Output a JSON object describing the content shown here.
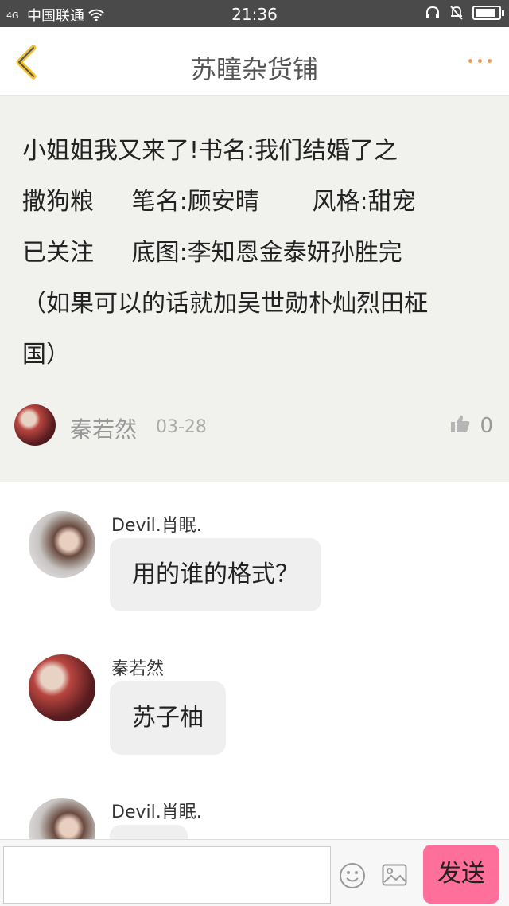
{
  "status_bar": {
    "network": "4G",
    "carrier": "中国联通",
    "time": "21:36",
    "battery_level": 0.85
  },
  "header": {
    "title": "苏瞳杂货铺",
    "accent_color": "#f29a55"
  },
  "post": {
    "lines": [
      "小姐姐我又来了!书名:我们结婚了之",
      "撒狗粮     笔名:顾安晴       风格:甜宠",
      "已关注     底图:李知恩金泰妍孙胜完",
      "（如果可以的话就加吴世勋朴灿烈田柾",
      "国）"
    ],
    "author": "秦若然",
    "date": "03-28",
    "likes": "0"
  },
  "comments": [
    {
      "user": "Devil.肖眠.",
      "text": "用的谁的格式？"
    },
    {
      "user": "秦若然",
      "text": "苏子柚"
    },
    {
      "user": "Devil.肖眠.",
      "text": ""
    }
  ],
  "input_bar": {
    "placeholder": "",
    "send_label": "发送",
    "send_color": "#ff6f9c"
  }
}
